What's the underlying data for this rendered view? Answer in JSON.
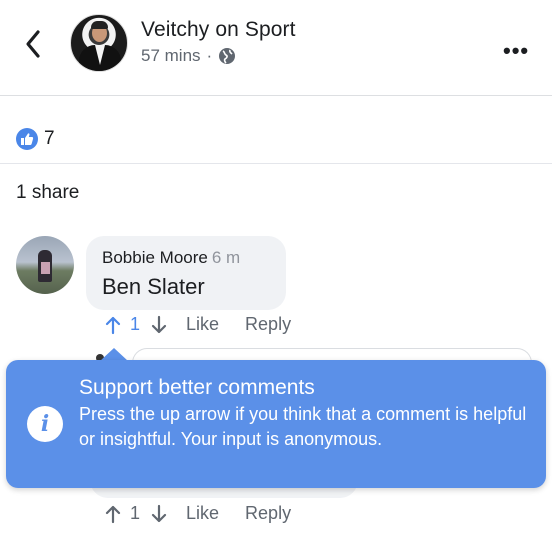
{
  "header": {
    "page_name": "Veitchy on Sport",
    "timestamp": "57 mins",
    "separator": "·",
    "more_label": "•••"
  },
  "reactions": {
    "like_count": "7"
  },
  "shares": {
    "label": "1 share"
  },
  "comment": {
    "author": "Bobbie Moore",
    "time": "6 m",
    "text": "Ben Slater",
    "vote_count": "1",
    "like_label": "Like",
    "reply_label": "Reply"
  },
  "comment2": {
    "vote_count": "1",
    "like_label": "Like",
    "reply_label": "Reply"
  },
  "tooltip": {
    "title": "Support better comments",
    "body": "Press the up arrow if you think that a comment is helpful or insightful. Your input is anonymous."
  },
  "colors": {
    "accent": "#5b90e8",
    "like_blue": "#4a86e8",
    "bubble_gray": "#f0f2f5"
  },
  "icons": [
    "back-chevron-icon",
    "globe-icon",
    "more-options-icon",
    "thumbs-up-icon",
    "up-arrow-icon",
    "down-arrow-icon",
    "info-icon"
  ]
}
